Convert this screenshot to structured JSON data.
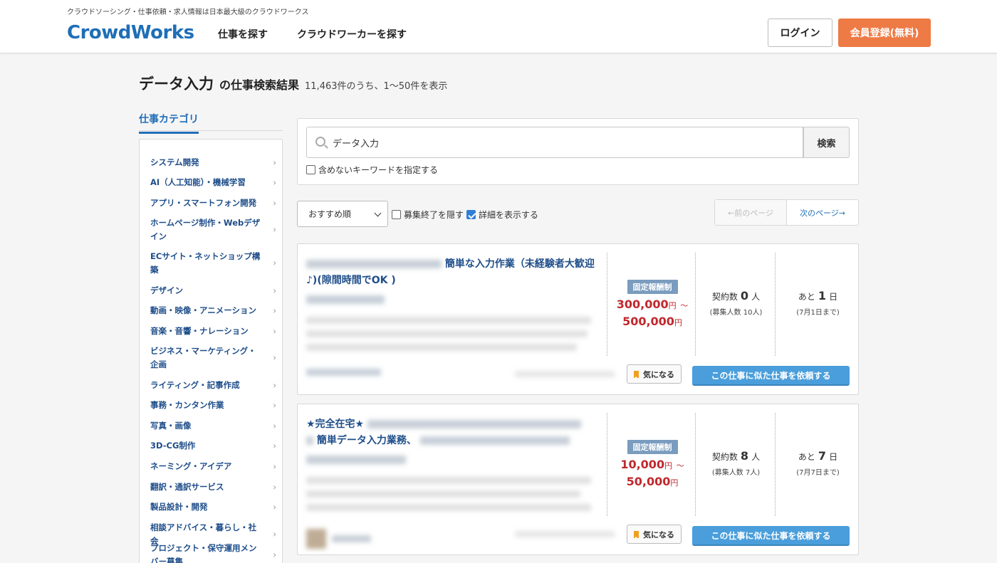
{
  "header": {
    "tagline": "クラウドソーシング・仕事依頼・求人情報は日本最大級のクラウドワークス",
    "logo": "CrowdWorks",
    "nav": [
      "仕事を探す",
      "クラウドワーカーを探す"
    ],
    "login_label": "ログイン",
    "signup_label": "会員登録(無料)"
  },
  "title": {
    "keyword": "データ入力",
    "suffix": "の仕事検索結果",
    "count": "11,463件のうち、1〜50件を表示"
  },
  "sidebar": {
    "heading": "仕事カテゴリ",
    "items": [
      "システム開発",
      "AI（人工知能）・機械学習",
      "アプリ・スマートフォン開発",
      "ホームページ制作・Webデザイン",
      "ECサイト・ネットショップ構築",
      "デザイン",
      "動画・映像・アニメーション",
      "音楽・音響・ナレーション",
      "ビジネス・マーケティング・企画",
      "ライティング・記事作成",
      "事務・カンタン作業",
      "写真・画像",
      "3D-CG制作",
      "ネーミング・アイデア",
      "翻訳・通訳サービス",
      "製品設計・開発",
      "相談アドバイス・暮らし・社会",
      "プロジェクト・保守運用メンバー募集"
    ]
  },
  "search": {
    "value": "データ入力",
    "button_label": "検索",
    "exclude_label": "含めないキーワードを指定する"
  },
  "sort": {
    "selected": "おすすめ順",
    "hide_closed_label": "募集終了を隠す",
    "show_details_label": "詳細を表示する"
  },
  "pager": {
    "prev_label": "←前のページ",
    "next_label": "次のページ→"
  },
  "jobs": [
    {
      "title_visible": "簡単な入力作業（未経験者大歓迎♪)(隙間時間でOK )",
      "pay_type": "固定報酬制",
      "pay_min": "300,000",
      "pay_max": "500,000",
      "yen": "円",
      "range_sep": "〜",
      "contracts_label": "契約数",
      "contracts": "0",
      "contracts_unit": "人",
      "recruit": "(募集人数 10人)",
      "days_label": "あと",
      "days": "1",
      "days_unit": "日",
      "deadline": "(7月1日まで)",
      "fav_label": "気になる",
      "request_label": "この仕事に似た仕事を依頼する"
    },
    {
      "title_prefix": "★完全在宅★",
      "title_visible": "簡単データ入力業務、",
      "pay_type": "固定報酬制",
      "pay_min": "10,000",
      "pay_max": "50,000",
      "yen": "円",
      "range_sep": "〜",
      "contracts_label": "契約数",
      "contracts": "8",
      "contracts_unit": "人",
      "recruit": "(募集人数 7人)",
      "days_label": "あと",
      "days": "7",
      "days_unit": "日",
      "deadline": "(7月7日まで)",
      "fav_label": "気になる",
      "request_label": "この仕事に似た仕事を依頼する"
    }
  ]
}
